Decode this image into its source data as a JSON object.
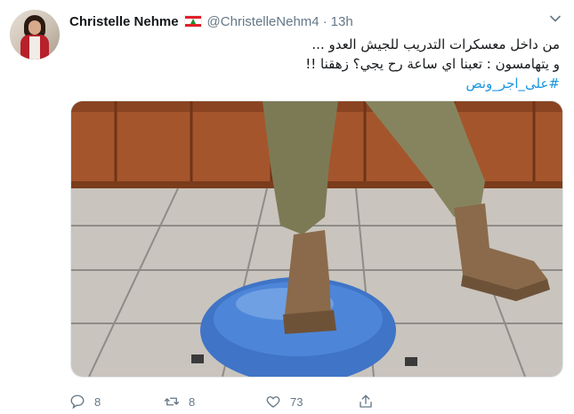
{
  "tweet": {
    "author_name": "Christelle Nehme",
    "flag_icon": "lebanon-flag-icon",
    "handle": "@ChristelleNehm4",
    "separator": "·",
    "time": "13h",
    "text_line1": "من داخل معسكرات التدريب للجيش العدو ...",
    "text_line2": "و يتهامسون : تعبنا اي ساعة رح يجي؟ زهقنا !!",
    "hashtag": "#على_اجر_ونص"
  },
  "actions": {
    "reply_count": "8",
    "retweet_count": "8",
    "like_count": "73"
  },
  "colors": {
    "link": "#1b95e0",
    "muted": "#657786"
  }
}
